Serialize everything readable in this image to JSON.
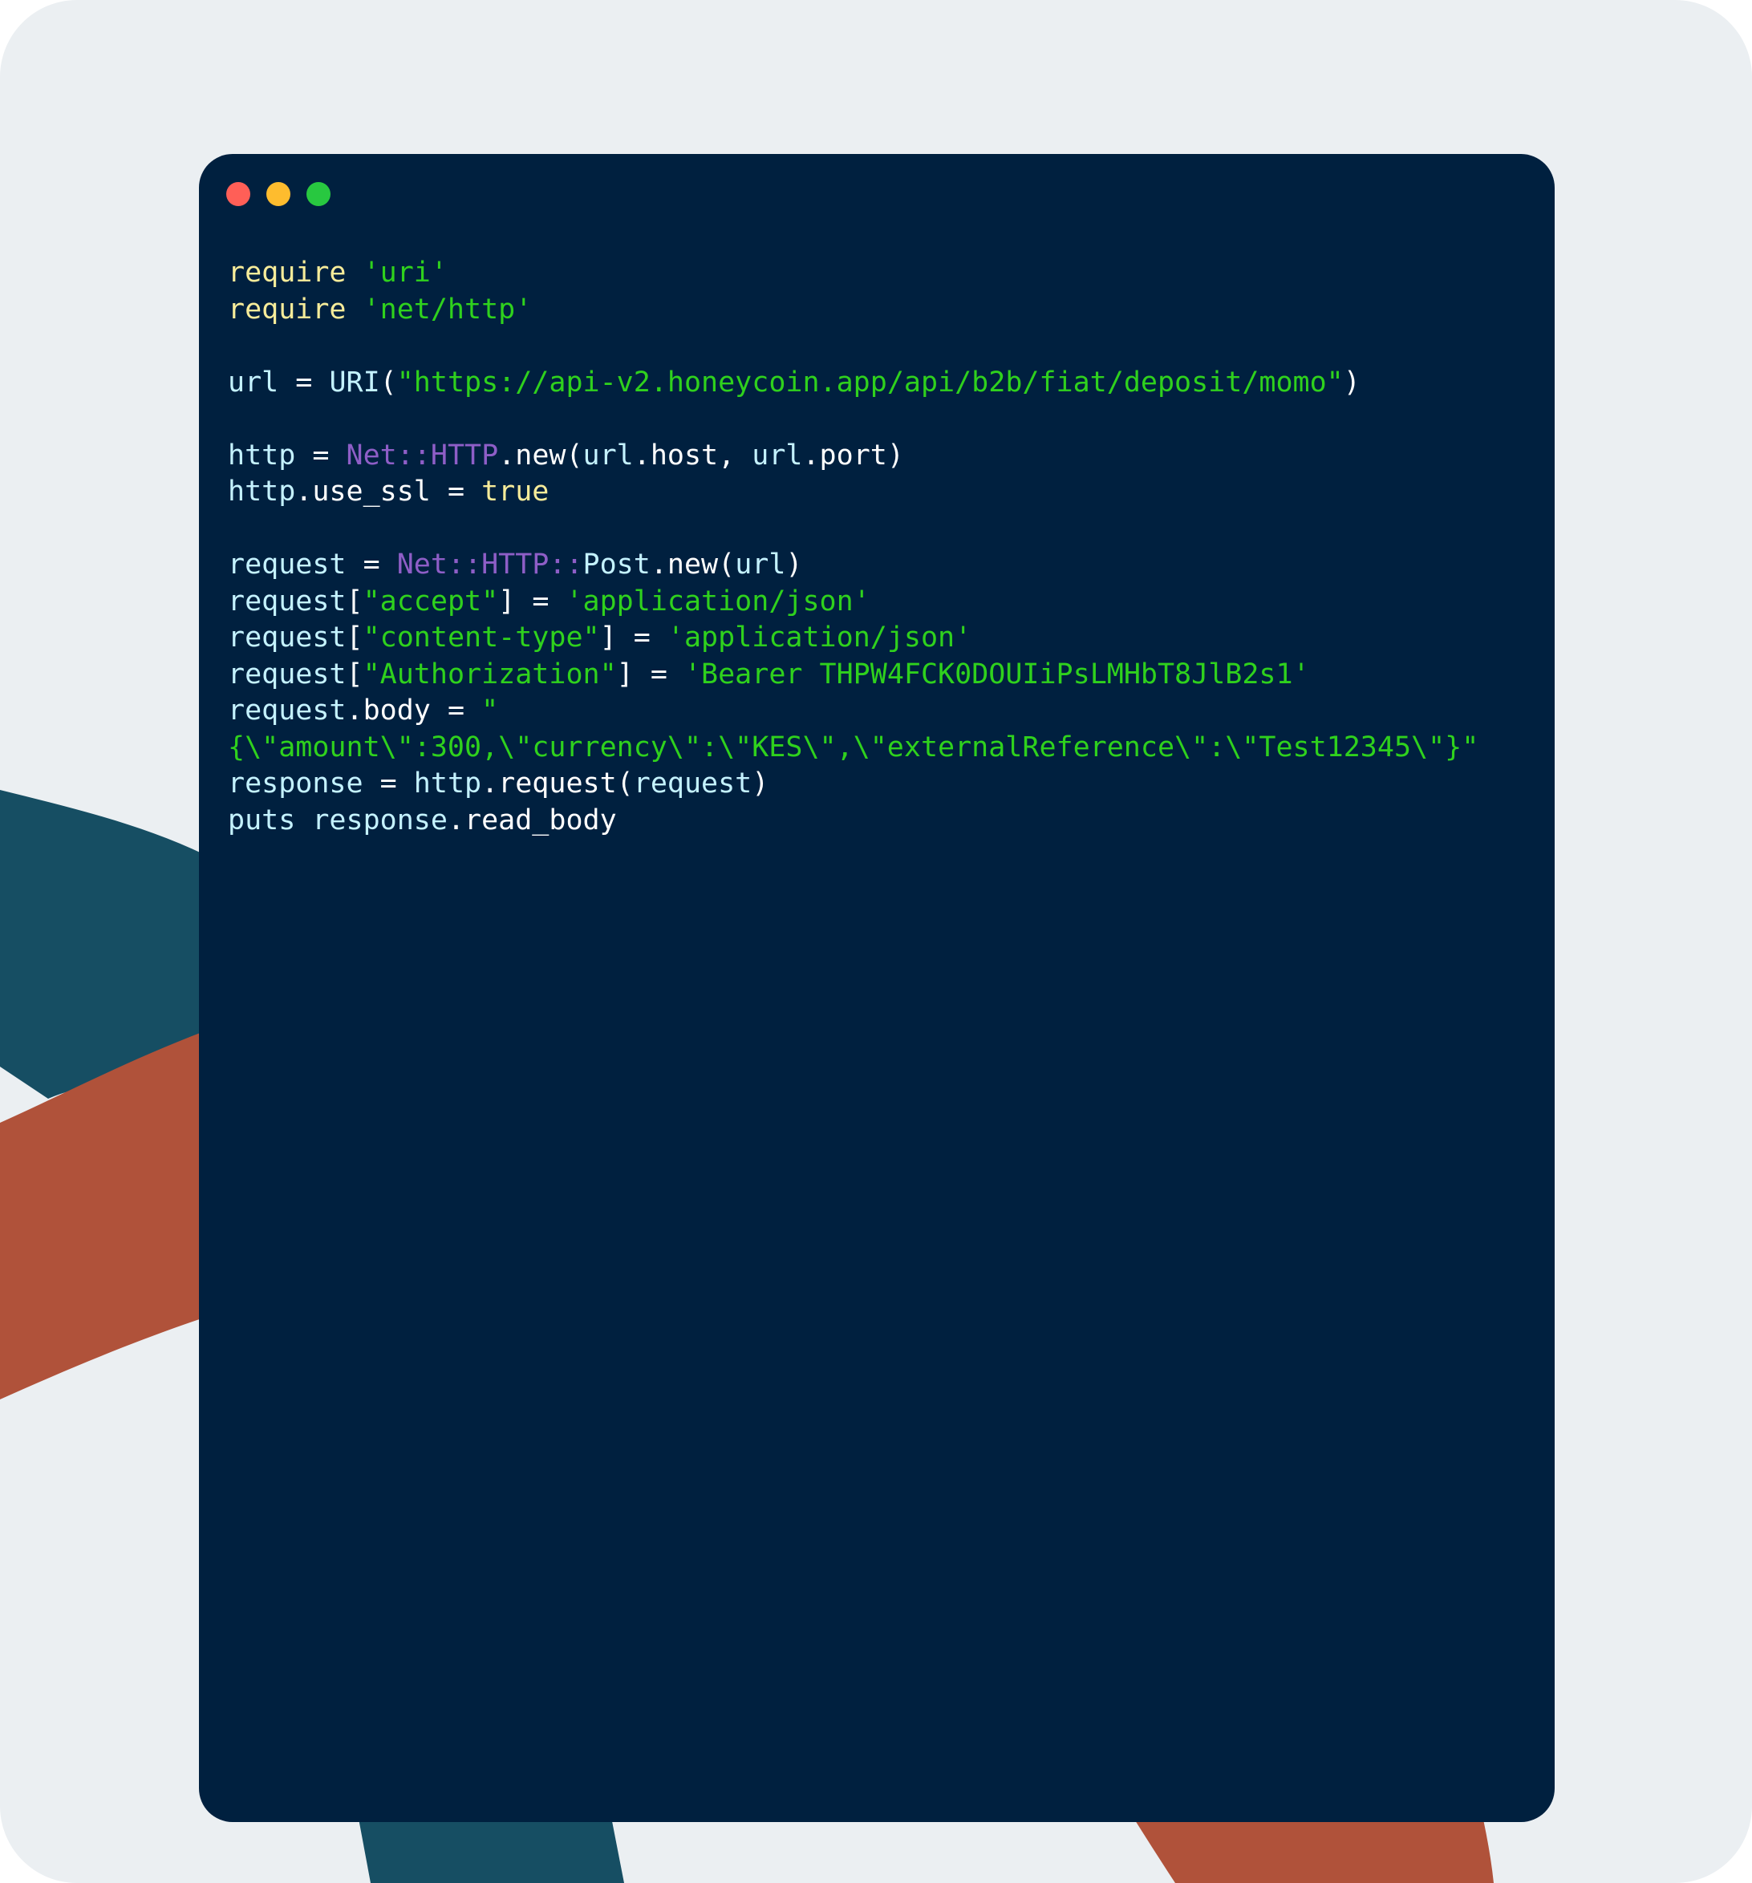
{
  "colors": {
    "page_background": "#ebeff2",
    "window_background": "#00203f",
    "teal_shape": "#164e63",
    "rust_shape": "#b0523a",
    "traffic_close": "#ff5f57",
    "traffic_minimize": "#febc2e",
    "traffic_maximize": "#28c840",
    "keyword": "#f7ec9a",
    "string": "#2fd11d",
    "variable": "#c4f2ff",
    "constant": "#8e5ec7",
    "plain": "#ffffff"
  },
  "window": {
    "buttons": [
      "close",
      "minimize",
      "maximize"
    ]
  },
  "code": {
    "language": "ruby",
    "lines": [
      [
        {
          "t": "kw",
          "v": "require "
        },
        {
          "t": "str",
          "v": "'uri'"
        }
      ],
      [
        {
          "t": "kw",
          "v": "require "
        },
        {
          "t": "str",
          "v": "'net/http'"
        }
      ],
      [],
      [
        {
          "t": "var",
          "v": "url"
        },
        {
          "t": "plain",
          "v": " = "
        },
        {
          "t": "var",
          "v": "URI"
        },
        {
          "t": "plain",
          "v": "("
        },
        {
          "t": "str",
          "v": "\"https://api-v2.honeycoin.app/api/b2b/fiat/deposit/momo\""
        },
        {
          "t": "plain",
          "v": ")"
        }
      ],
      [],
      [
        {
          "t": "var",
          "v": "http"
        },
        {
          "t": "plain",
          "v": " = "
        },
        {
          "t": "const",
          "v": "Net::HTTP"
        },
        {
          "t": "plain",
          "v": ".new("
        },
        {
          "t": "var",
          "v": "url"
        },
        {
          "t": "plain",
          "v": ".host, "
        },
        {
          "t": "var",
          "v": "url"
        },
        {
          "t": "plain",
          "v": ".port)"
        }
      ],
      [
        {
          "t": "var",
          "v": "http"
        },
        {
          "t": "plain",
          "v": ".use_ssl = "
        },
        {
          "t": "kw",
          "v": "true"
        }
      ],
      [],
      [
        {
          "t": "var",
          "v": "request"
        },
        {
          "t": "plain",
          "v": " = "
        },
        {
          "t": "const",
          "v": "Net::HTTP::"
        },
        {
          "t": "var",
          "v": "Post"
        },
        {
          "t": "plain",
          "v": ".new("
        },
        {
          "t": "var",
          "v": "url"
        },
        {
          "t": "plain",
          "v": ")"
        }
      ],
      [
        {
          "t": "var",
          "v": "request"
        },
        {
          "t": "plain",
          "v": "["
        },
        {
          "t": "str",
          "v": "\"accept\""
        },
        {
          "t": "plain",
          "v": "] = "
        },
        {
          "t": "str",
          "v": "'application/json'"
        }
      ],
      [
        {
          "t": "var",
          "v": "request"
        },
        {
          "t": "plain",
          "v": "["
        },
        {
          "t": "str",
          "v": "\"content-type\""
        },
        {
          "t": "plain",
          "v": "] = "
        },
        {
          "t": "str",
          "v": "'application/json'"
        }
      ],
      [
        {
          "t": "var",
          "v": "request"
        },
        {
          "t": "plain",
          "v": "["
        },
        {
          "t": "str",
          "v": "\"Authorization\""
        },
        {
          "t": "plain",
          "v": "] = "
        },
        {
          "t": "str",
          "v": "'Bearer THPW4FCK0DOUIiPsLMHbT8JlB2s1'"
        }
      ],
      [
        {
          "t": "var",
          "v": "request"
        },
        {
          "t": "plain",
          "v": ".body = "
        },
        {
          "t": "str",
          "v": "\""
        }
      ],
      [
        {
          "t": "str",
          "v": "{\\\"amount\\\":300,\\\"currency\\\":\\\"KES\\\",\\\"externalReference\\\":\\\"Test12345\\\"}\""
        }
      ],
      [
        {
          "t": "var",
          "v": "response"
        },
        {
          "t": "plain",
          "v": " = "
        },
        {
          "t": "var",
          "v": "http"
        },
        {
          "t": "plain",
          "v": ".request("
        },
        {
          "t": "var",
          "v": "request"
        },
        {
          "t": "plain",
          "v": ")"
        }
      ],
      [
        {
          "t": "var",
          "v": "puts response"
        },
        {
          "t": "plain",
          "v": ".read_body"
        }
      ]
    ]
  }
}
